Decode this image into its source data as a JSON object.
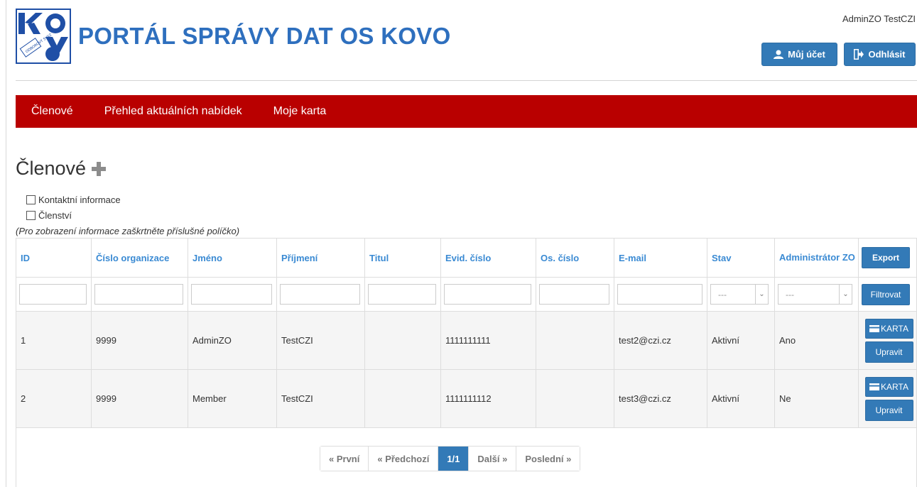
{
  "header": {
    "site_title": "PORTÁL SPRÁVY DAT OS KOVO",
    "logo_text": "KOVO",
    "user_name": "AdminZO TestCZI",
    "account_button": "Můj účet",
    "logout_button": "Odhlásit"
  },
  "nav": {
    "items": [
      "Členové",
      "Přehled aktuálních nabídek",
      "Moje karta"
    ]
  },
  "page": {
    "title": "Členové",
    "checkbox_contact": "Kontaktní informace",
    "checkbox_membership": "Členství",
    "hint": "(Pro zobrazení informace zaškrtněte příslušné políčko)"
  },
  "table": {
    "headers": [
      "ID",
      "Číslo organizace",
      "Jméno",
      "Příjmení",
      "Titul",
      "Evid. číslo",
      "Os. číslo",
      "E-mail",
      "Stav",
      "Administrátor ZO"
    ],
    "export_button": "Export",
    "filter_button": "Filtrovat",
    "select_placeholder": "---",
    "card_button": "KARTA",
    "edit_button": "Upravit",
    "rows": [
      [
        "1",
        "9999",
        "AdminZO",
        "TestCZI",
        "",
        "1111111111",
        "",
        "test2@czi.cz",
        "Aktivní",
        "Ano"
      ],
      [
        "2",
        "9999",
        "Member",
        "TestCZI",
        "",
        "1111111112",
        "",
        "test3@czi.cz",
        "Aktivní",
        "Ne"
      ]
    ]
  },
  "pagination": {
    "first": "« První",
    "prev": "« Předchozí",
    "current": "1/1",
    "next": "Další »",
    "last": "Poslední »"
  },
  "colors": {
    "brand_red": "#b90000",
    "primary_blue": "#337ab7",
    "title_blue": "#2e6fbe",
    "header_link_blue": "#3a8ad3"
  }
}
